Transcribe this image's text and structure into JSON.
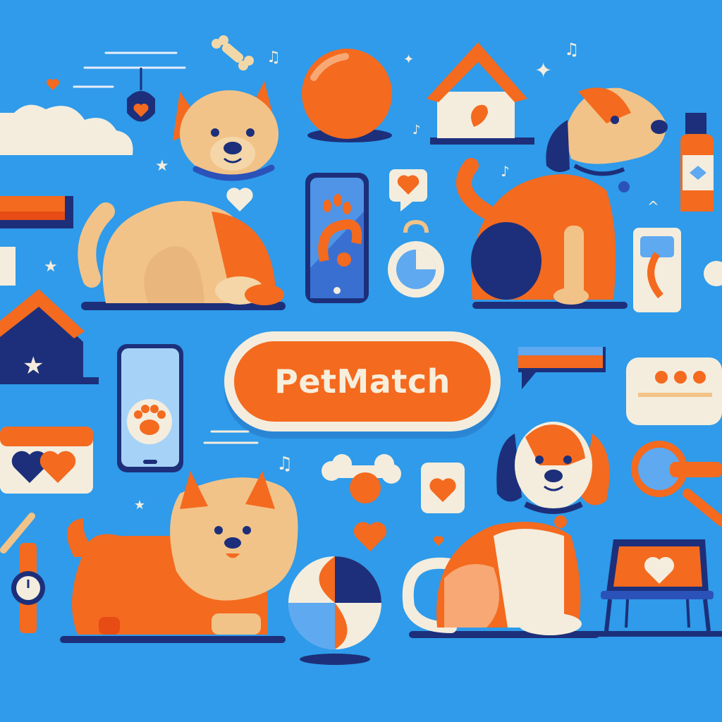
{
  "brand": {
    "name": "PetMatch"
  },
  "colors": {
    "background": "#2f9bea",
    "accent_orange": "#f46a1f",
    "cream": "#f4eddd",
    "tan": "#f2c388",
    "navy": "#1d2f7a"
  },
  "icons": [
    "dog-sitting-tan",
    "dog-sitting-hound",
    "dog-fluffy",
    "dog-beagle",
    "orange-ball",
    "beach-ball",
    "bone-toy",
    "phone-paw",
    "phone-app",
    "dog-house",
    "heart-icon",
    "chat-bubble",
    "cloud",
    "collar-tag",
    "pet-bed",
    "shampoo-bottle",
    "magnifier-icon",
    "watch",
    "music-note-icon",
    "star-icon"
  ]
}
